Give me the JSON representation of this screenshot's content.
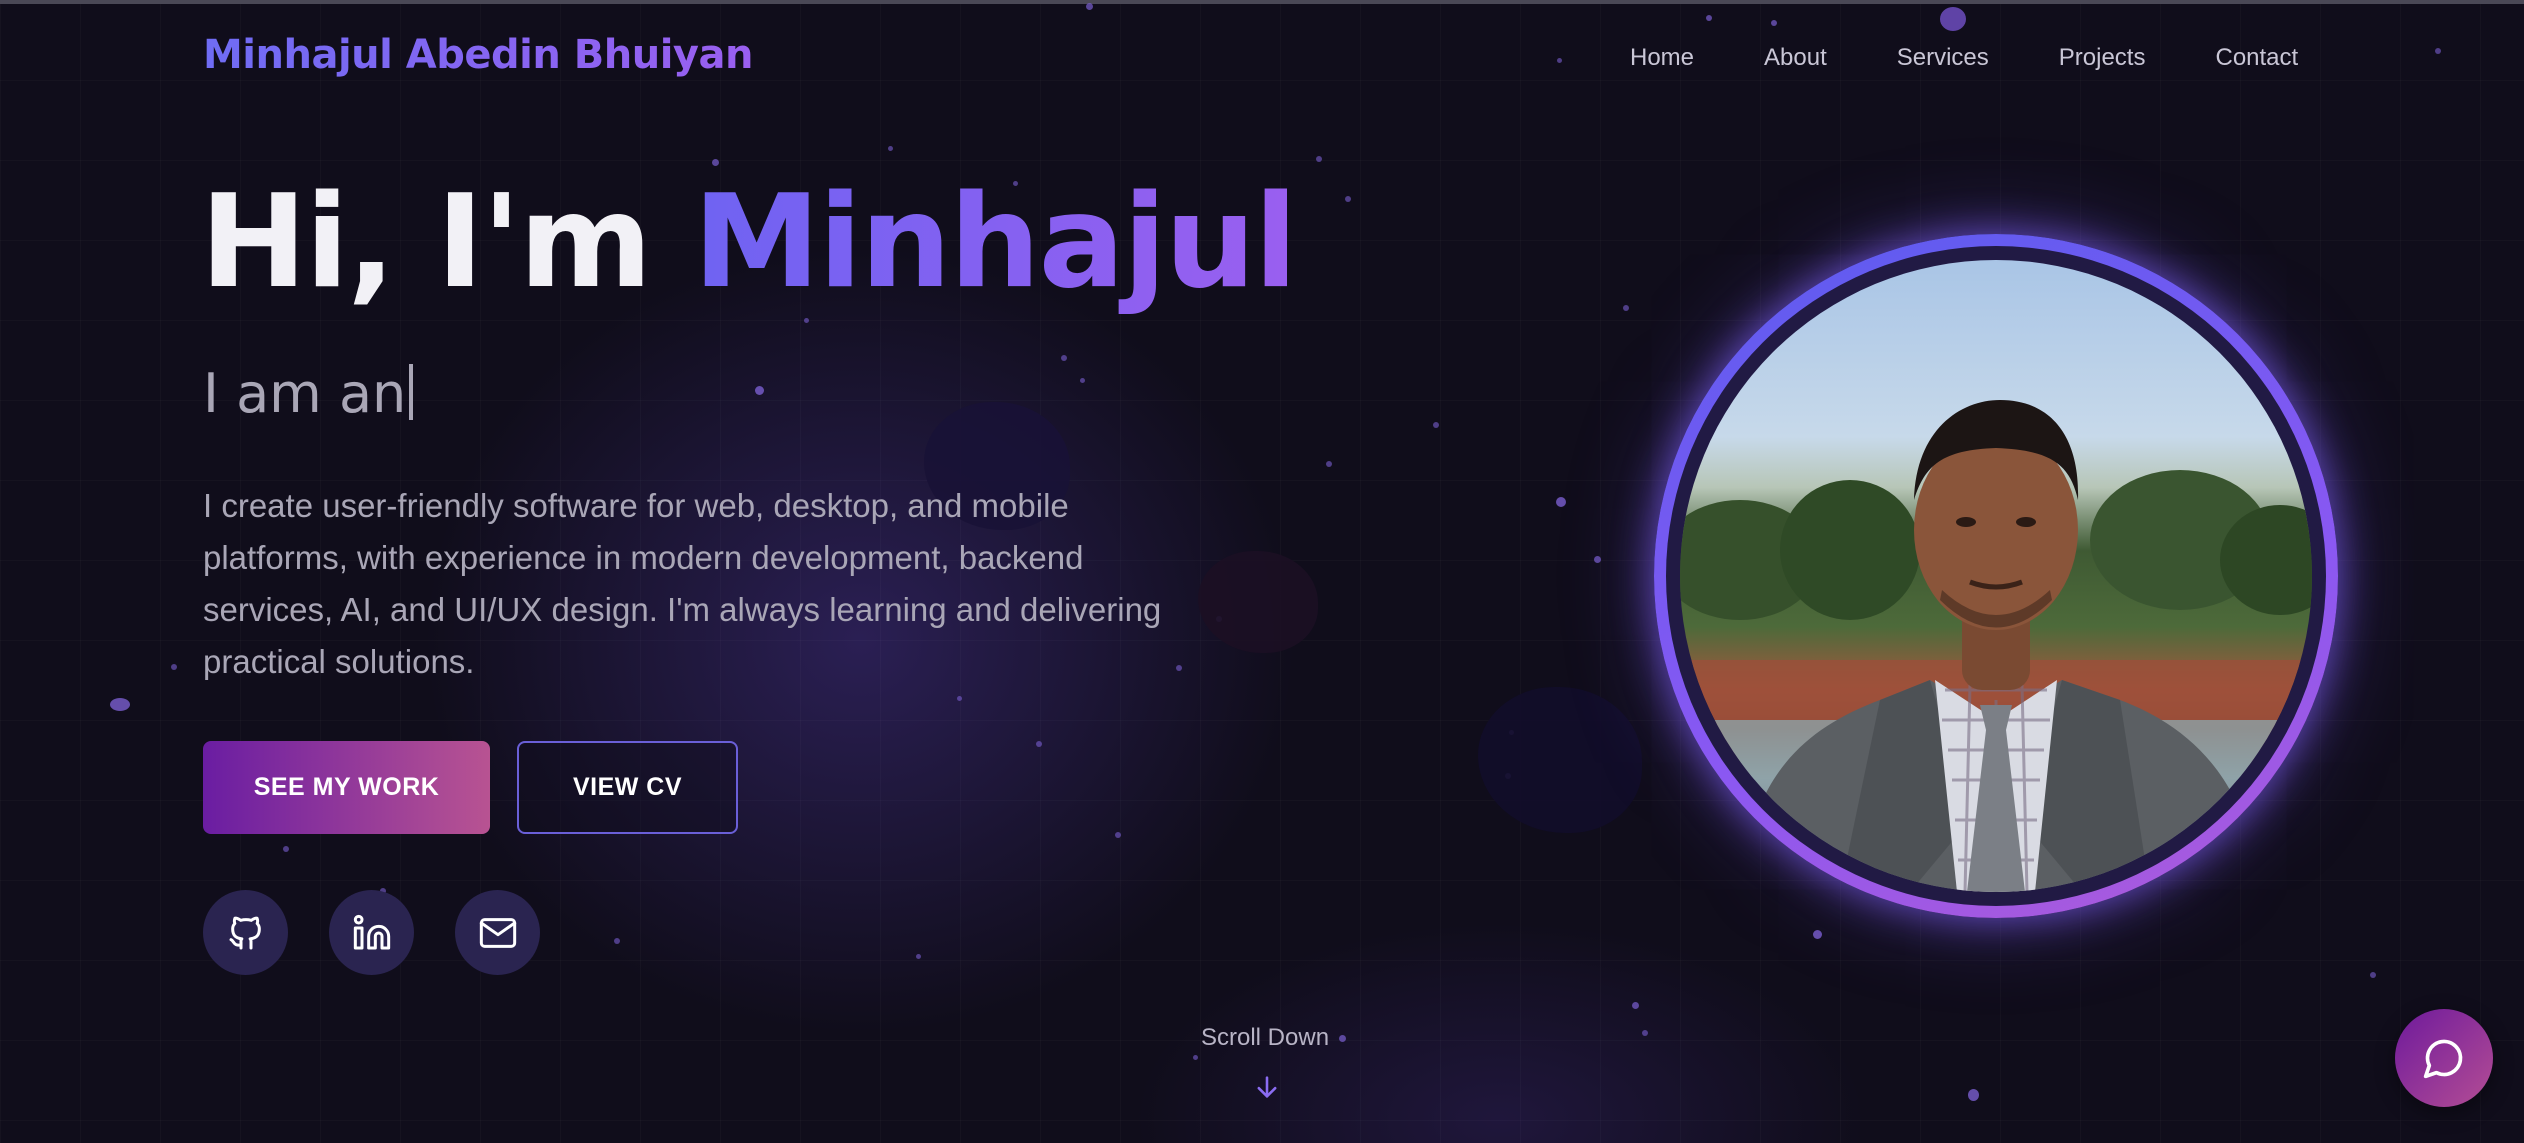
{
  "header": {
    "brand": "Minhajul Abedin Bhuiyan",
    "nav": [
      "Home",
      "About",
      "Services",
      "Projects",
      "Contact"
    ]
  },
  "hero": {
    "greeting": "Hi, I'm ",
    "name": "Minhajul",
    "typed_text": "I am an",
    "description": "I create user-friendly software for web, desktop, and mobile platforms, with experience in modern development, backend services, AI, and UI/UX design. I'm always learning and delivering practical solutions.",
    "primary_button": "SEE MY WORK",
    "secondary_button": "VIEW CV"
  },
  "social": {
    "icons": [
      "github-icon",
      "linkedin-icon",
      "mail-icon"
    ]
  },
  "scroll": {
    "label": "Scroll Down",
    "icon": "arrow-down-icon"
  },
  "chat": {
    "icon": "chat-bubble-icon"
  },
  "colors": {
    "background": "#100d1b",
    "accent_blue": "#6f63f2",
    "accent_purple": "#9a5ff0",
    "button_gradient_start": "#6a1da2",
    "button_gradient_end": "#b85392"
  }
}
